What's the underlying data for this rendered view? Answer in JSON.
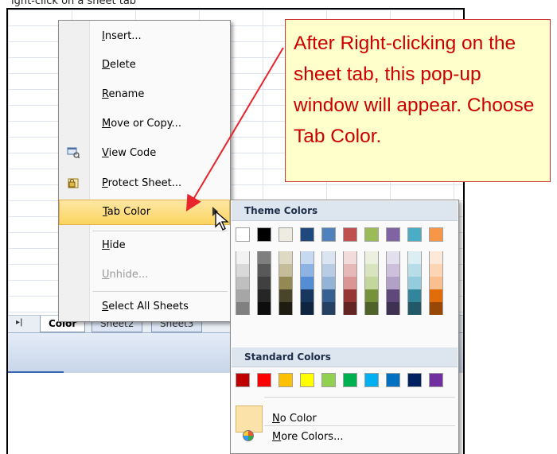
{
  "caption_fragment": "ight-click on a sheet tab",
  "sheet_tabs": {
    "nav_symbol": "▸|",
    "tabs": [
      "Color",
      "Sheet2",
      "Sheet3"
    ]
  },
  "context_menu": {
    "items": [
      {
        "label": "Insert...",
        "icon": null,
        "disabled": false,
        "highlighted": false
      },
      {
        "label": "Delete",
        "icon": null,
        "disabled": false,
        "highlighted": false
      },
      {
        "label": "Rename",
        "icon": null,
        "disabled": false,
        "highlighted": false
      },
      {
        "label": "Move or Copy...",
        "icon": null,
        "disabled": false,
        "highlighted": false
      },
      {
        "label": "View Code",
        "icon": "view-code-icon",
        "disabled": false,
        "highlighted": false
      },
      {
        "label": "Protect Sheet...",
        "icon": "protect-sheet-icon",
        "disabled": false,
        "highlighted": false
      },
      {
        "label": "Tab Color",
        "icon": null,
        "disabled": false,
        "highlighted": true,
        "submenu": true
      },
      {
        "label": "Hide",
        "icon": null,
        "disabled": false,
        "highlighted": false
      },
      {
        "label": "Unhide...",
        "icon": null,
        "disabled": true,
        "highlighted": false
      },
      {
        "label": "Select All Sheets",
        "icon": null,
        "disabled": false,
        "highlighted": false
      }
    ]
  },
  "palette": {
    "theme_heading": "Theme Colors",
    "theme_base": [
      "#ffffff",
      "#000000",
      "#eeece1",
      "#1f497d",
      "#4f81bd",
      "#c0504d",
      "#9bbb59",
      "#8064a2",
      "#4bacc6",
      "#f79646"
    ],
    "theme_tints": [
      [
        "#f2f2f2",
        "#d9d9d9",
        "#bfbfbf",
        "#a6a6a6",
        "#808080"
      ],
      [
        "#7f7f7f",
        "#595959",
        "#404040",
        "#262626",
        "#0d0d0d"
      ],
      [
        "#ddd9c3",
        "#c4bd97",
        "#938953",
        "#4a452a",
        "#1e1c11"
      ],
      [
        "#c6d9f1",
        "#8db3e2",
        "#548dd4",
        "#17375e",
        "#0f243e"
      ],
      [
        "#dbe5f1",
        "#b8cce4",
        "#95b3d7",
        "#366092",
        "#244062"
      ],
      [
        "#f2dcdb",
        "#e6b9b8",
        "#da9694",
        "#963634",
        "#632523"
      ],
      [
        "#ebf1de",
        "#d7e4bd",
        "#c3d69b",
        "#76933c",
        "#4f6228"
      ],
      [
        "#e4dfec",
        "#ccc0da",
        "#b2a1c7",
        "#5f497a",
        "#3f3151"
      ],
      [
        "#dbeef4",
        "#b7dee8",
        "#93cddd",
        "#31869b",
        "#215968"
      ],
      [
        "#fde9d9",
        "#fcd5b4",
        "#fabf8f",
        "#e26b0a",
        "#974706"
      ]
    ],
    "standard_heading": "Standard Colors",
    "standard": [
      "#c00000",
      "#ff0000",
      "#ffc000",
      "#ffff00",
      "#92d050",
      "#00b050",
      "#00b0f0",
      "#0070c0",
      "#002060",
      "#7030a0"
    ],
    "no_color_label": "No Color",
    "more_colors_label": "More Colors..."
  },
  "callout": {
    "text": "After Right-clicking on the sheet tab, this pop-up window will appear. Choose Tab Color.",
    "text_color": "#cc0000",
    "background": "#ffffcc"
  }
}
